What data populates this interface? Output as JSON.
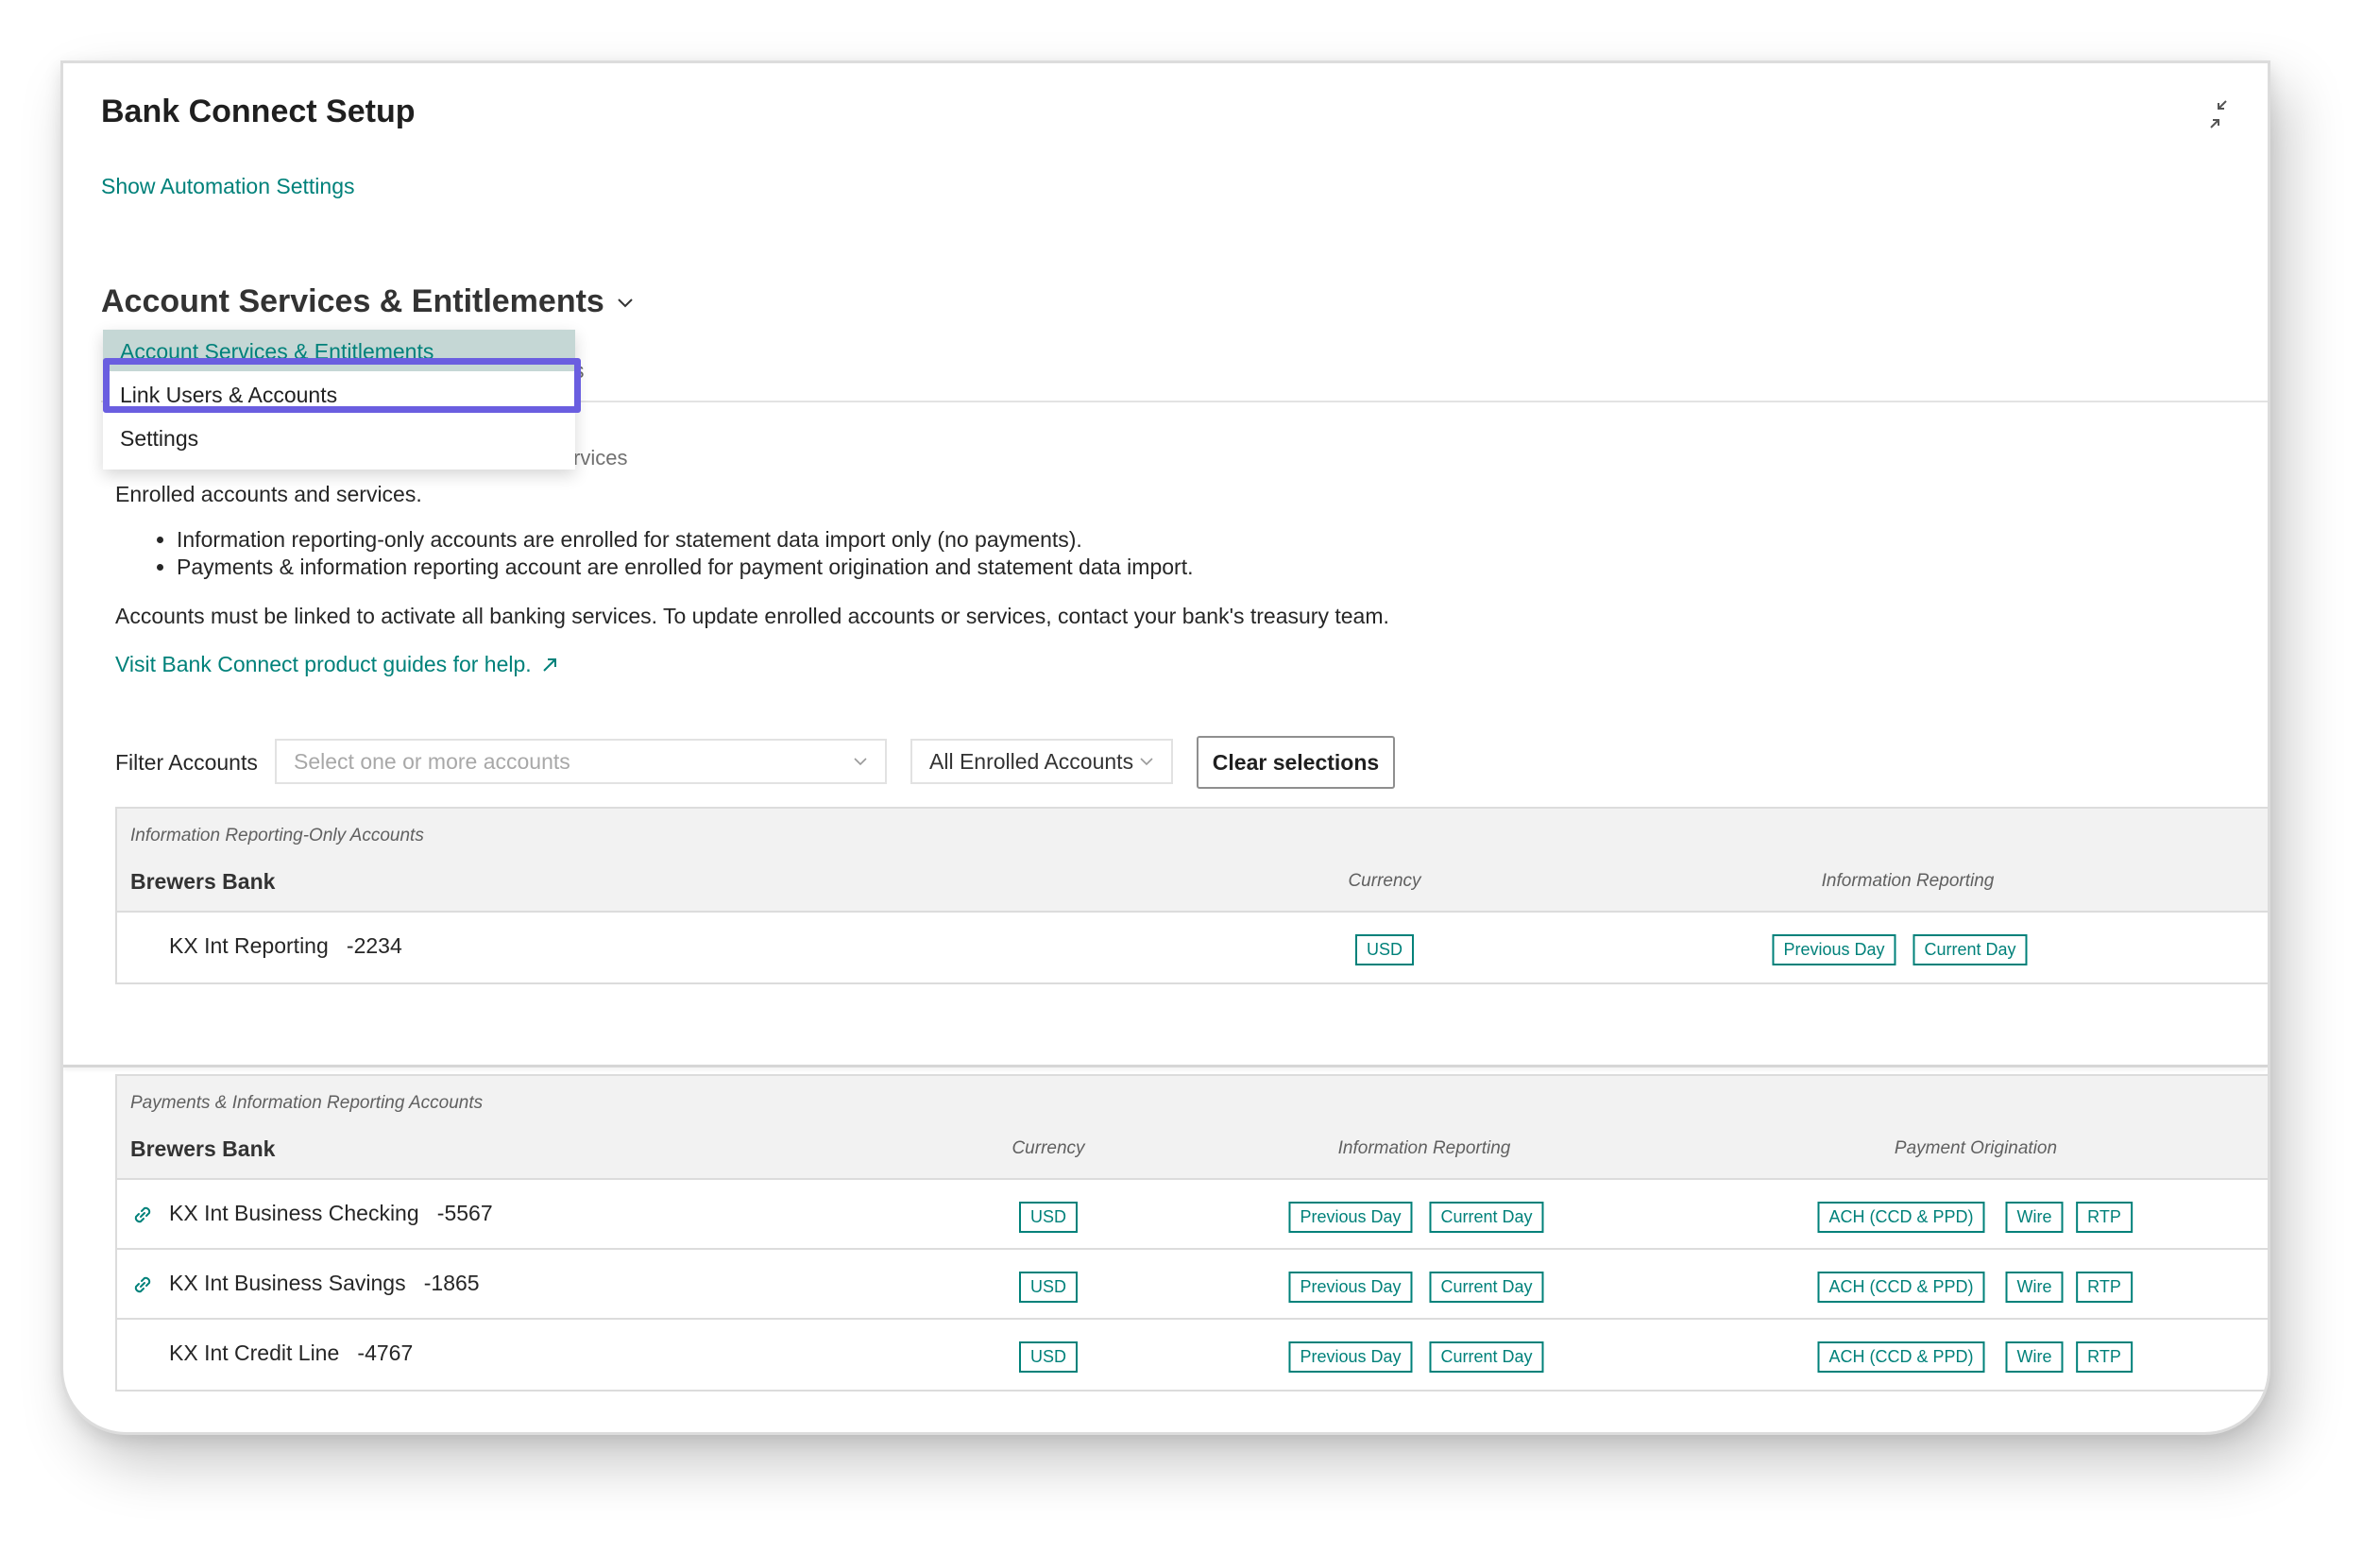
{
  "window": {
    "title": "Bank Connect Setup",
    "collapse_icon": "collapse-arrows-icon",
    "automation_link": "Show Automation Settings"
  },
  "section": {
    "title": "Account Services & Entitlements",
    "tab_remnant": "s",
    "subtab_remnant": "rvices"
  },
  "menu": {
    "items": [
      {
        "label": "Account Services & Entitlements",
        "state": "selected"
      },
      {
        "label": "Link Users & Accounts",
        "state": "highlighted"
      },
      {
        "label": "Settings",
        "state": "normal"
      }
    ],
    "highlight_color": "#6a5ee0"
  },
  "description": {
    "intro": "Enrolled accounts and services.",
    "bullets": [
      "Information reporting-only accounts are enrolled for statement data import only (no payments).",
      "Payments & information reporting account are enrolled for payment origination and statement data import."
    ],
    "note": "Accounts must be linked to activate all banking services. To update enrolled accounts or services, contact your bank's treasury team.",
    "guides_link": "Visit Bank Connect product guides for help."
  },
  "filter": {
    "label": "Filter Accounts",
    "placeholder": "Select one or more accounts",
    "enrolled_value": "All Enrolled Accounts",
    "clear_label": "Clear selections"
  },
  "reporting_table": {
    "caption": "Information Reporting-Only Accounts",
    "bank": "Brewers Bank",
    "columns": {
      "currency": "Currency",
      "info": "Information Reporting"
    },
    "rows": [
      {
        "account": "KX Int Reporting   -2234",
        "linked": false,
        "currency": "USD",
        "info": [
          "Previous Day",
          "Current Day"
        ]
      }
    ]
  },
  "payments_table": {
    "caption": "Payments & Information Reporting Accounts",
    "bank": "Brewers Bank",
    "columns": {
      "currency": "Currency",
      "info": "Information Reporting",
      "payment": "Payment Origination"
    },
    "rows": [
      {
        "account": "KX Int Business Checking   -5567",
        "linked": true,
        "currency": "USD",
        "info": [
          "Previous Day",
          "Current Day"
        ],
        "payment": [
          "ACH (CCD & PPD)",
          "Wire",
          "RTP"
        ]
      },
      {
        "account": "KX Int Business Savings   -1865",
        "linked": true,
        "currency": "USD",
        "info": [
          "Previous Day",
          "Current Day"
        ],
        "payment": [
          "ACH (CCD & PPD)",
          "Wire",
          "RTP"
        ]
      },
      {
        "account": "KX Int Credit Line   -4767",
        "linked": false,
        "currency": "USD",
        "info": [
          "Previous Day",
          "Current Day"
        ],
        "payment": [
          "ACH (CCD & PPD)",
          "Wire",
          "RTP"
        ]
      }
    ]
  },
  "colors": {
    "accent": "#00817a",
    "menu_selected_bg": "#c5d7d5",
    "header_bg": "#f2f2f2"
  }
}
